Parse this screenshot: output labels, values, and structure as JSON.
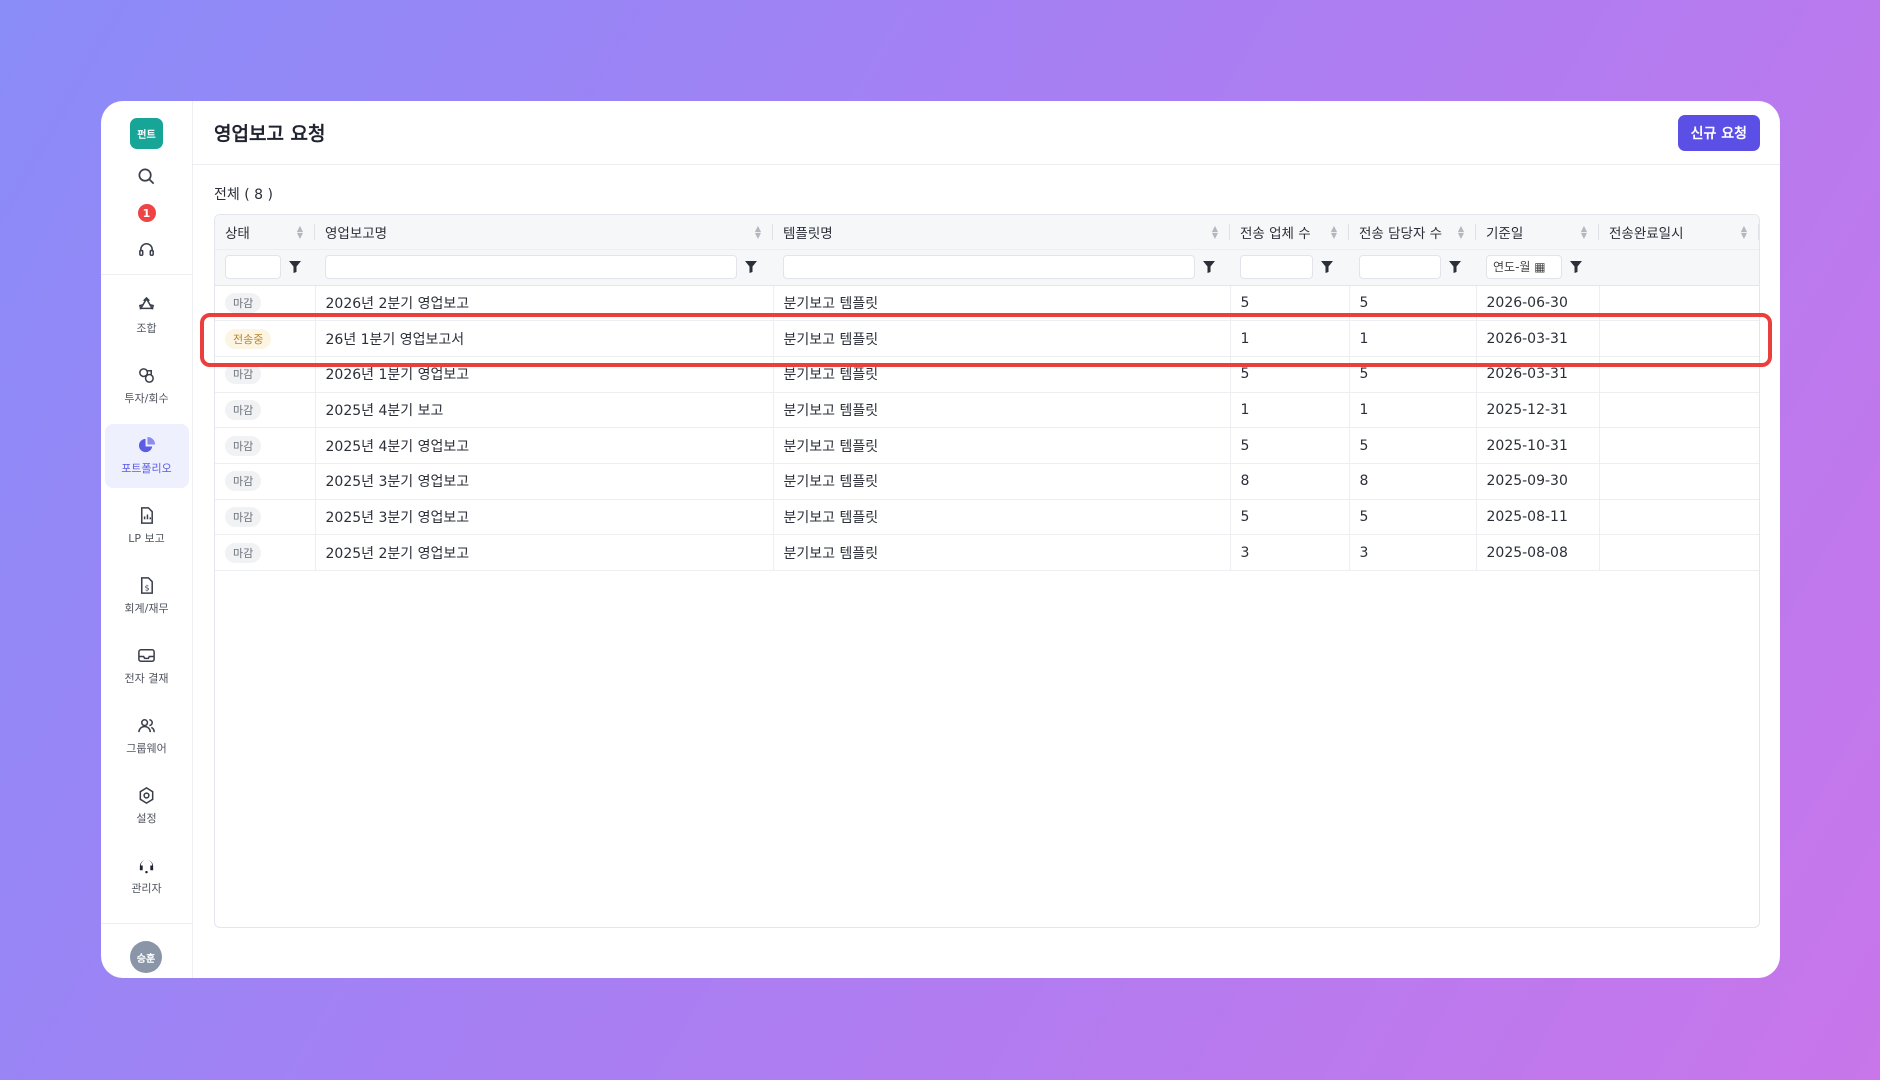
{
  "sidebar": {
    "logo": "펀트",
    "notification_count": "1",
    "items": [
      {
        "label": "조합",
        "icon": "recycle-icon"
      },
      {
        "label": "투자/회수",
        "icon": "investment-icon"
      },
      {
        "label": "포트폴리오",
        "icon": "pie-chart-icon"
      },
      {
        "label": "LP 보고",
        "icon": "report-icon"
      },
      {
        "label": "회계/재무",
        "icon": "accounting-icon"
      },
      {
        "label": "전자 결재",
        "icon": "inbox-icon"
      },
      {
        "label": "그룹웨어",
        "icon": "people-icon"
      },
      {
        "label": "설정",
        "icon": "gear-icon"
      },
      {
        "label": "관리자",
        "icon": "headset-icon"
      }
    ],
    "active_item": "포트폴리오",
    "user_initials": "승훈"
  },
  "header": {
    "title": "영업보고 요청",
    "new_request_label": "신규 요청"
  },
  "list": {
    "count_label": "전체 ( 8 )"
  },
  "table": {
    "columns": [
      "상태",
      "영업보고명",
      "템플릿명",
      "전송 업체 수",
      "전송 담당자 수",
      "기준일",
      "전송완료일시"
    ],
    "date_filter_placeholder": "연도-월",
    "rows": [
      {
        "status": "마감",
        "name": "2026년 2분기 영업보고",
        "template": "분기보고 템플릿",
        "companies": "5",
        "managers": "5",
        "base_date": "2026-06-30",
        "completed": ""
      },
      {
        "status": "전송중",
        "name": "26년 1분기 영업보고서",
        "template": "분기보고 템플릿",
        "companies": "1",
        "managers": "1",
        "base_date": "2026-03-31",
        "completed": ""
      },
      {
        "status": "마감",
        "name": "2026년 1분기 영업보고",
        "template": "분기보고 템플릿",
        "companies": "5",
        "managers": "5",
        "base_date": "2026-03-31",
        "completed": ""
      },
      {
        "status": "마감",
        "name": "2025년 4분기 보고",
        "template": "분기보고 템플릿",
        "companies": "1",
        "managers": "1",
        "base_date": "2025-12-31",
        "completed": ""
      },
      {
        "status": "마감",
        "name": "2025년 4분기 영업보고",
        "template": "분기보고 템플릿",
        "companies": "5",
        "managers": "5",
        "base_date": "2025-10-31",
        "completed": ""
      },
      {
        "status": "마감",
        "name": "2025년 3분기 영업보고",
        "template": "분기보고 템플릿",
        "companies": "8",
        "managers": "8",
        "base_date": "2025-09-30",
        "completed": ""
      },
      {
        "status": "마감",
        "name": "2025년 3분기 영업보고",
        "template": "분기보고 템플릿",
        "companies": "5",
        "managers": "5",
        "base_date": "2025-08-11",
        "completed": ""
      },
      {
        "status": "마감",
        "name": "2025년 2분기 영업보고",
        "template": "분기보고 템플릿",
        "companies": "3",
        "managers": "3",
        "base_date": "2025-08-08",
        "completed": ""
      }
    ]
  },
  "colors": {
    "accent": "#5b4fe6",
    "logo": "#16a596",
    "highlight": "#ea3f3c",
    "sending_badge": "#b7862a"
  }
}
